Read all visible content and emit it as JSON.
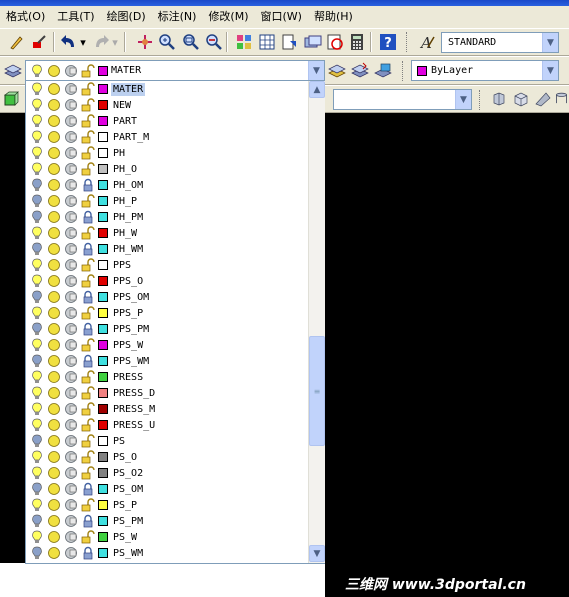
{
  "menubar": {
    "items": [
      "格式(O)",
      "工具(T)",
      "绘图(D)",
      "标注(N)",
      "修改(M)",
      "窗口(W)",
      "帮助(H)"
    ]
  },
  "text_style": {
    "value": "STANDARD"
  },
  "layer_combo": {
    "value": "MATER"
  },
  "color_combo": {
    "value": "ByLayer",
    "color": "#e000e0"
  },
  "layers": [
    {
      "name": "MATER",
      "color": "#e000e0",
      "on": true,
      "locked": false,
      "selected": true
    },
    {
      "name": "NEW",
      "color": "#e00000",
      "on": true,
      "locked": false
    },
    {
      "name": "PART",
      "color": "#e000e0",
      "on": true,
      "locked": false
    },
    {
      "name": "PART_M",
      "color": "#ffffff",
      "on": true,
      "locked": false
    },
    {
      "name": "PH",
      "color": "#ffffff",
      "on": true,
      "locked": false
    },
    {
      "name": "PH_O",
      "color": "#c0c0c0",
      "on": true,
      "locked": false
    },
    {
      "name": "PH_OM",
      "color": "#40e0e0",
      "on": false,
      "locked": true
    },
    {
      "name": "PH_P",
      "color": "#40e0e0",
      "on": false,
      "locked": false
    },
    {
      "name": "PH_PM",
      "color": "#40e0e0",
      "on": false,
      "locked": true
    },
    {
      "name": "PH_W",
      "color": "#e00000",
      "on": true,
      "locked": false
    },
    {
      "name": "PH_WM",
      "color": "#40e0e0",
      "on": false,
      "locked": true
    },
    {
      "name": "PPS",
      "color": "#ffffff",
      "on": true,
      "locked": false
    },
    {
      "name": "PPS_O",
      "color": "#e00000",
      "on": true,
      "locked": false
    },
    {
      "name": "PPS_OM",
      "color": "#40e0e0",
      "on": false,
      "locked": true
    },
    {
      "name": "PPS_P",
      "color": "#ffff40",
      "on": true,
      "locked": false
    },
    {
      "name": "PPS_PM",
      "color": "#40e0e0",
      "on": false,
      "locked": true
    },
    {
      "name": "PPS_W",
      "color": "#e000e0",
      "on": true,
      "locked": false
    },
    {
      "name": "PPS_WM",
      "color": "#40e0e0",
      "on": false,
      "locked": true
    },
    {
      "name": "PRESS",
      "color": "#40d040",
      "on": true,
      "locked": false
    },
    {
      "name": "PRESS_D",
      "color": "#f08080",
      "on": true,
      "locked": false
    },
    {
      "name": "PRESS_M",
      "color": "#a00000",
      "on": true,
      "locked": false
    },
    {
      "name": "PRESS_U",
      "color": "#e00000",
      "on": true,
      "locked": false
    },
    {
      "name": "PS",
      "color": "#ffffff",
      "on": false,
      "locked": false
    },
    {
      "name": "PS_O",
      "color": "#808080",
      "on": true,
      "locked": false
    },
    {
      "name": "PS_O2",
      "color": "#808080",
      "on": true,
      "locked": false
    },
    {
      "name": "PS_OM",
      "color": "#40e0e0",
      "on": false,
      "locked": true
    },
    {
      "name": "PS_P",
      "color": "#ffff40",
      "on": true,
      "locked": false
    },
    {
      "name": "PS_PM",
      "color": "#40e0e0",
      "on": false,
      "locked": true
    },
    {
      "name": "PS_W",
      "color": "#40d040",
      "on": true,
      "locked": false
    },
    {
      "name": "PS_WM",
      "color": "#40e0e0",
      "on": false,
      "locked": true
    }
  ],
  "watermark": "三维网 www.3dportal.cn",
  "colors": {
    "toolbar_bg": "#ece9d8",
    "selection": "#bcd0ef",
    "combo_arrow": "#c1d3fb",
    "model_space": "#000000"
  }
}
